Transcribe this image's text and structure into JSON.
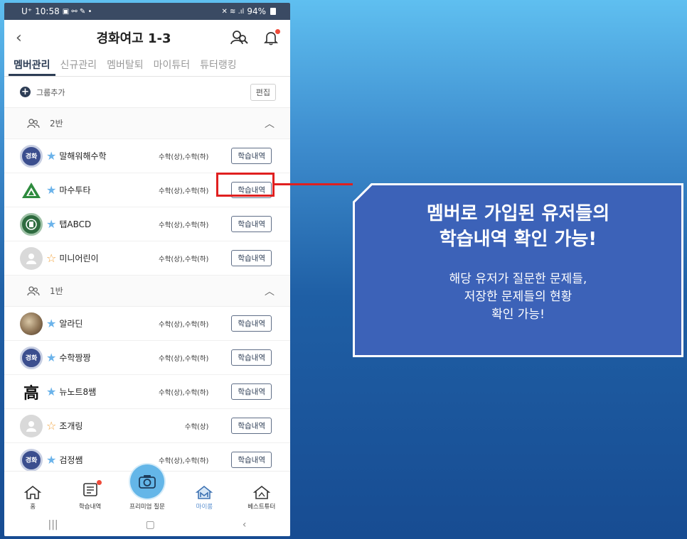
{
  "status_bar": {
    "carrier": "U⁺",
    "time": "10:58",
    "battery": "94%"
  },
  "header": {
    "title": "경화여고 1-3"
  },
  "tabs": [
    "멤버관리",
    "신규관리",
    "멤버탈퇴",
    "마이튜터",
    "튜터랭킹"
  ],
  "toolbar": {
    "add_group_label": "그룹추가",
    "edit_label": "편집"
  },
  "groups": [
    {
      "title": "2반",
      "members": [
        {
          "name": "말해워해수학",
          "subjects": "수학(상),수학(하)",
          "button": "학습내역",
          "starred": true,
          "avatar": "crest",
          "avatar_text": "경화"
        },
        {
          "name": "마수투타",
          "subjects": "수학(상),수학(하)",
          "button": "학습내역",
          "starred": true,
          "avatar": "triangle",
          "avatar_text": ""
        },
        {
          "name": "탭ABCD",
          "subjects": "수학(상),수학(하)",
          "button": "학습내역",
          "starred": true,
          "avatar": "green",
          "avatar_text": ""
        },
        {
          "name": "미니어린이",
          "subjects": "수학(상),수학(하)",
          "button": "학습내역",
          "starred": false,
          "avatar": "default",
          "avatar_text": ""
        }
      ]
    },
    {
      "title": "1반",
      "members": [
        {
          "name": "알라딘",
          "subjects": "수학(상),수학(하)",
          "button": "학습내역",
          "starred": true,
          "avatar": "photo",
          "avatar_text": ""
        },
        {
          "name": "수학짱짱",
          "subjects": "수학(상),수학(하)",
          "button": "학습내역",
          "starred": true,
          "avatar": "crest",
          "avatar_text": "경화"
        },
        {
          "name": "뉴노트8쌤",
          "subjects": "수학(상),수학(하)",
          "button": "학습내역",
          "starred": true,
          "avatar": "hanja",
          "avatar_text": "高"
        },
        {
          "name": "조개링",
          "subjects": "수학(상)",
          "button": "학습내역",
          "starred": false,
          "avatar": "default",
          "avatar_text": ""
        },
        {
          "name": "검정쌤",
          "subjects": "수학(상),수학(하)",
          "button": "학습내역",
          "starred": true,
          "avatar": "crest",
          "avatar_text": "경화"
        }
      ]
    }
  ],
  "bottom_nav": [
    {
      "label": "홈",
      "icon": "home-icon",
      "active": false
    },
    {
      "label": "학습내역",
      "icon": "notebook-icon",
      "active": false
    },
    {
      "label": "프리미엄 질문",
      "icon": "camera-icon",
      "active": false
    },
    {
      "label": "마이룸",
      "icon": "myroom-icon",
      "active": true
    },
    {
      "label": "베스트튜터",
      "icon": "best-tutor-icon",
      "active": false
    }
  ],
  "callout": {
    "title_line1": "멤버로 가입된 유저들의",
    "title_line2": "학습내역 확인 가능!",
    "body_line1": "해당 유저가 질문한 문제들,",
    "body_line2": "저장한 문제들의 현황",
    "body_line3": "확인 가능!"
  },
  "colors": {
    "primary": "#2d3d55",
    "accent": "#64b6e8",
    "highlight": "#e02020",
    "callout": "#3c62b8"
  }
}
